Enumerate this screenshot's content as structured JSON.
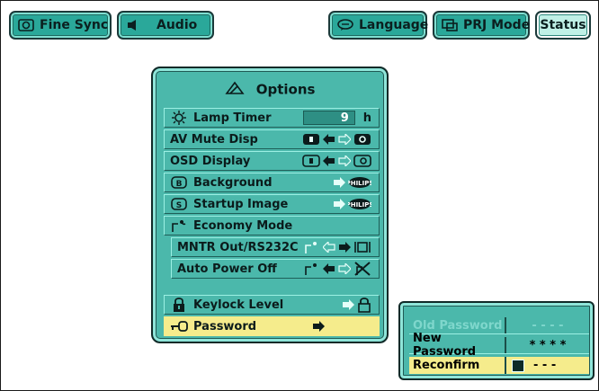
{
  "tabs": {
    "fine_sync": "Fine Sync",
    "audio": "Audio",
    "language": "Language",
    "prj_mode": "PRJ Mode",
    "status": "Status"
  },
  "options": {
    "title": "Options",
    "lamp_timer": {
      "label": "Lamp Timer",
      "value": "9",
      "unit": "h"
    },
    "av_mute": {
      "label": "AV Mute Disp"
    },
    "osd": {
      "label": "OSD Display"
    },
    "background": {
      "label": "Background"
    },
    "startup": {
      "label": "Startup Image"
    },
    "economy": {
      "label": "Economy Mode"
    },
    "mntr": {
      "label": "MNTR Out/RS232C"
    },
    "auto_power": {
      "label": "Auto Power Off"
    },
    "keylock": {
      "label": "Keylock Level"
    },
    "password": {
      "label": "Password"
    },
    "brand": "PHILIPS"
  },
  "password_panel": {
    "old_label": "Old Password",
    "old_value": "- - - -",
    "new_label": "New Password",
    "new_value": "* * * *",
    "reconfirm_label": "Reconfirm",
    "reconfirm_value": "- - -"
  },
  "colors": {
    "panel": "#4bb8ab",
    "highlight": "#f5ec8c",
    "tab_selected": "#bff0e6"
  }
}
